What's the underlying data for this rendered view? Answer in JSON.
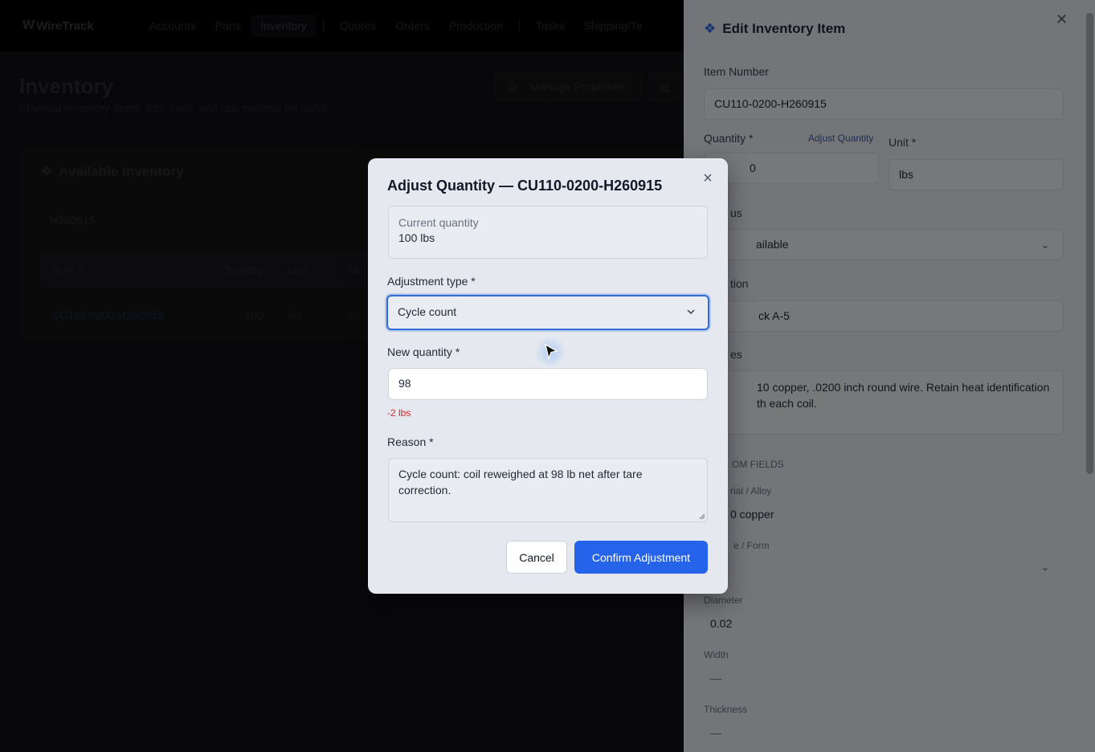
{
  "nav": {
    "brand": "WireTrack",
    "links": [
      "Accounts",
      "Parts",
      "Inventory",
      "Quotes",
      "Orders",
      "Production",
      "Tasks",
      "Shipping/Te"
    ]
  },
  "page": {
    "title": "Inventory",
    "subtitle": "Physical inventory items, lots, coils, and raw material on hand.",
    "manage_properties": "Manage Properties",
    "card_title": "Available Inventory",
    "search_value": "H260915",
    "columns": [
      "Item #",
      "Quantity",
      "Unit",
      "Sc"
    ],
    "row": {
      "item": "CU110-0200-H260915",
      "quantity": "100",
      "unit": "lbs",
      "extra": "20"
    }
  },
  "side_panel": {
    "title": "Edit Inventory Item",
    "item_number_label": "Item Number",
    "item_number": "CU110-0200-H260915",
    "quantity_label": "Quantity *",
    "quantity_partial": "0",
    "adjust_quantity_link": "Adjust Quantity",
    "unit_label": "Unit *",
    "unit": "lbs",
    "status_label_partial": "us",
    "status_partial": "ailable",
    "location_label_partial": "tion",
    "location_partial": "ck A-5",
    "notes_label_partial": "es",
    "notes_line1": "10 copper, .0200 inch round wire. Retain heat identification",
    "notes_line2": "th each coil.",
    "custom_fields_partial": "OM FIELDS",
    "material_label_partial": "rial / Alloy",
    "material_partial": "0 copper",
    "shape_label_partial": "e / Form",
    "diameter_label": "Diameter",
    "diameter": "0.02",
    "width_label": "Width",
    "width": "—",
    "thickness_label": "Thickness",
    "thickness": "—"
  },
  "modal": {
    "title": "Adjust Quantity — CU110-0200-H260915",
    "current_label": "Current quantity",
    "current_value": "100 lbs",
    "adjustment_type_label": "Adjustment type *",
    "adjustment_type": "Cycle count",
    "new_quantity_label": "New quantity *",
    "new_quantity": "98",
    "delta": "-2 lbs",
    "reason_label": "Reason *",
    "reason": "Cycle count: coil reweighed at 98 lb net after tare correction.",
    "cancel": "Cancel",
    "confirm": "Confirm Adjustment"
  },
  "colors": {
    "accent": "#2563eb",
    "delta": "#dc2626"
  }
}
